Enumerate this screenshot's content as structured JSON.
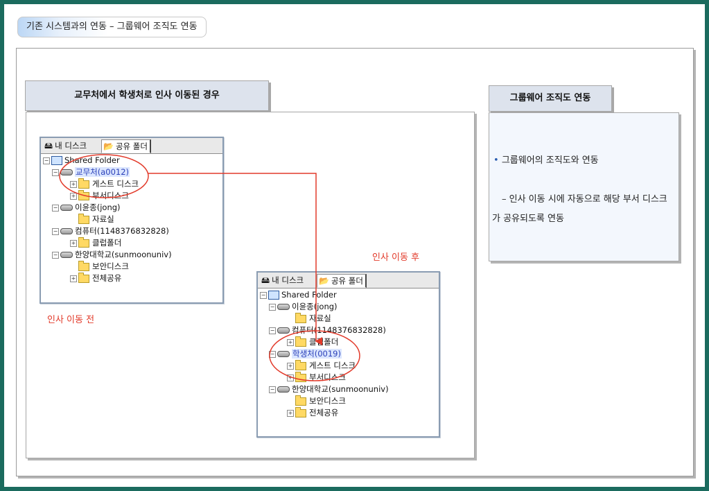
{
  "title": "기존 시스템과의 연동 – 그룹웨어 조직도 연동",
  "left_header": "교무처에서 학생처로 인사 이동된 경우",
  "right_header": "그룹웨어 조직도 연동",
  "right_panel": {
    "bullet": "•",
    "line1": "그룹웨어의 조직도와 연동",
    "line2": "– 인사 이동 시에 자동으로 해당 부서 디스크가 공유되도록 연동"
  },
  "notes": {
    "before": "인사 이동 전",
    "after": "인사 이동 후"
  },
  "tabs": {
    "my_disk": "내 디스크",
    "shared": "공유 폴더"
  },
  "icons": {
    "my_disk": "disk-user-icon",
    "shared": "shared-folder-icon",
    "root": "computer-icon",
    "drive": "drive-icon",
    "folder": "folder-icon"
  },
  "colors": {
    "frame": "#1b6b5e",
    "annotation": "#e23a2a",
    "highlight": "#2a3fb8",
    "header_bg": "#dde3ed"
  },
  "tree_before": {
    "root": "Shared Folder",
    "rows": [
      {
        "label": "교무처(a0012)"
      },
      {
        "label": "게스트 디스크"
      },
      {
        "label": "부서디스크"
      },
      {
        "label": "이윤종(jong)"
      },
      {
        "label": "자료실"
      },
      {
        "label": "컴퓨터(1148376832828)"
      },
      {
        "label": "클럽폴더"
      },
      {
        "label": "한양대학교(sunmoonuniv)"
      },
      {
        "label": "보안디스크"
      },
      {
        "label": "전체공유"
      }
    ]
  },
  "tree_after": {
    "root": "Shared Folder",
    "rows": [
      {
        "label": "이윤종(jong)"
      },
      {
        "label": "자료실"
      },
      {
        "label": "컴퓨터(1148376832828)"
      },
      {
        "label": "클럽폴더"
      },
      {
        "label": "학생처(0019)"
      },
      {
        "label": "게스트 디스크"
      },
      {
        "label": "부서디스크"
      },
      {
        "label": "한양대학교(sunmoonuniv)"
      },
      {
        "label": "보안디스크"
      },
      {
        "label": "전체공유"
      }
    ]
  }
}
